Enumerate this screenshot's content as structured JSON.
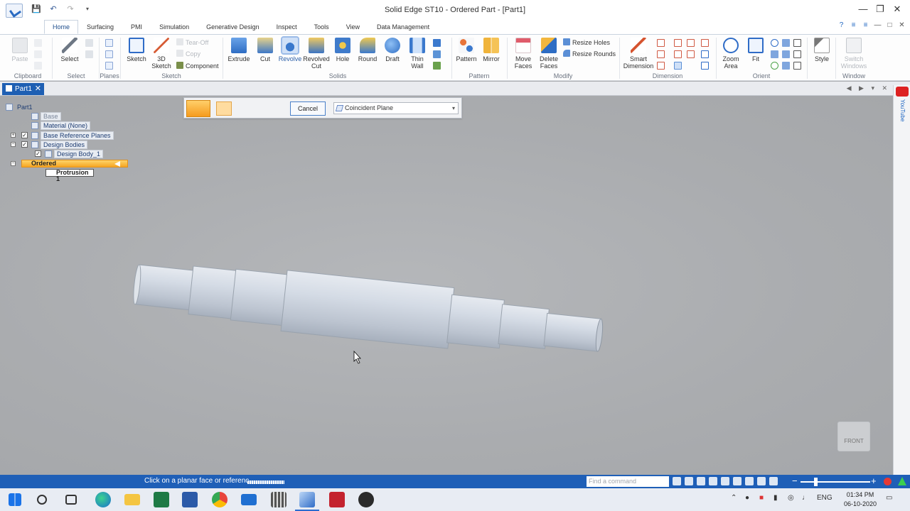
{
  "window": {
    "title": "Solid Edge ST10 - Ordered Part - [Part1]",
    "controls": [
      "—",
      "❐",
      "✕"
    ]
  },
  "ribbon_tabs": [
    "Home",
    "Surfacing",
    "PMI",
    "Simulation",
    "Generative Design",
    "Inspect",
    "Tools",
    "View",
    "Data Management"
  ],
  "ribbon": {
    "clipboard": {
      "label": "Clipboard",
      "paste": "Paste"
    },
    "select": {
      "label": "Select",
      "select": "Select"
    },
    "planes": {
      "label": "Planes"
    },
    "sketch": {
      "label": "Sketch",
      "sketch": "Sketch",
      "sketch3d_line1": "3D",
      "sketch3d_line2": "Sketch",
      "tearoff": "Tear-Off",
      "copy": "Copy",
      "component": "Component"
    },
    "solids": {
      "label": "Solids",
      "extrude": "Extrude",
      "cut": "Cut",
      "revolve": "Revolve",
      "revolved_cut_line1": "Revolved",
      "revolved_cut_line2": "Cut",
      "hole": "Hole",
      "round": "Round",
      "draft": "Draft",
      "thin_wall_line1": "Thin",
      "thin_wall_line2": "Wall"
    },
    "pattern": {
      "label": "Pattern",
      "pattern": "Pattern",
      "mirror": "Mirror"
    },
    "modify": {
      "label": "Modify",
      "move_faces_line1": "Move",
      "move_faces_line2": "Faces",
      "delete_faces_line1": "Delete",
      "delete_faces_line2": "Faces",
      "resize_holes": "Resize Holes",
      "resize_rounds": "Resize Rounds"
    },
    "dimension": {
      "label": "Dimension",
      "smart_line1": "Smart",
      "smart_line2": "Dimension"
    },
    "orient": {
      "label": "Orient",
      "zoom_line1": "Zoom",
      "zoom_line2": "Area",
      "fit": "Fit"
    },
    "style": {
      "label": "Style"
    },
    "window": {
      "label": "Window",
      "switch_line1": "Switch",
      "switch_line2": "Windows"
    }
  },
  "document_tab": {
    "name": "Part1"
  },
  "pathfinder": {
    "root": "Part1",
    "base": "Base",
    "material": "Material (None)",
    "ref_planes": "Base Reference Planes",
    "design_bodies": "Design Bodies",
    "design_body_1": "Design Body_1",
    "ordered": "Ordered",
    "protrusion": "Protrusion 1"
  },
  "command_bar": {
    "cancel": "Cancel",
    "plane_option": "Coincident Plane"
  },
  "viewcube": {
    "face": "FRONT"
  },
  "status": {
    "prompt": "Click on a planar face or referenc",
    "find_placeholder": "Find a command"
  },
  "taskbar": {
    "language": "ENG",
    "time": "01:34 PM",
    "date": "06-10-2020"
  },
  "right_rail": {
    "label": "YouTube"
  }
}
